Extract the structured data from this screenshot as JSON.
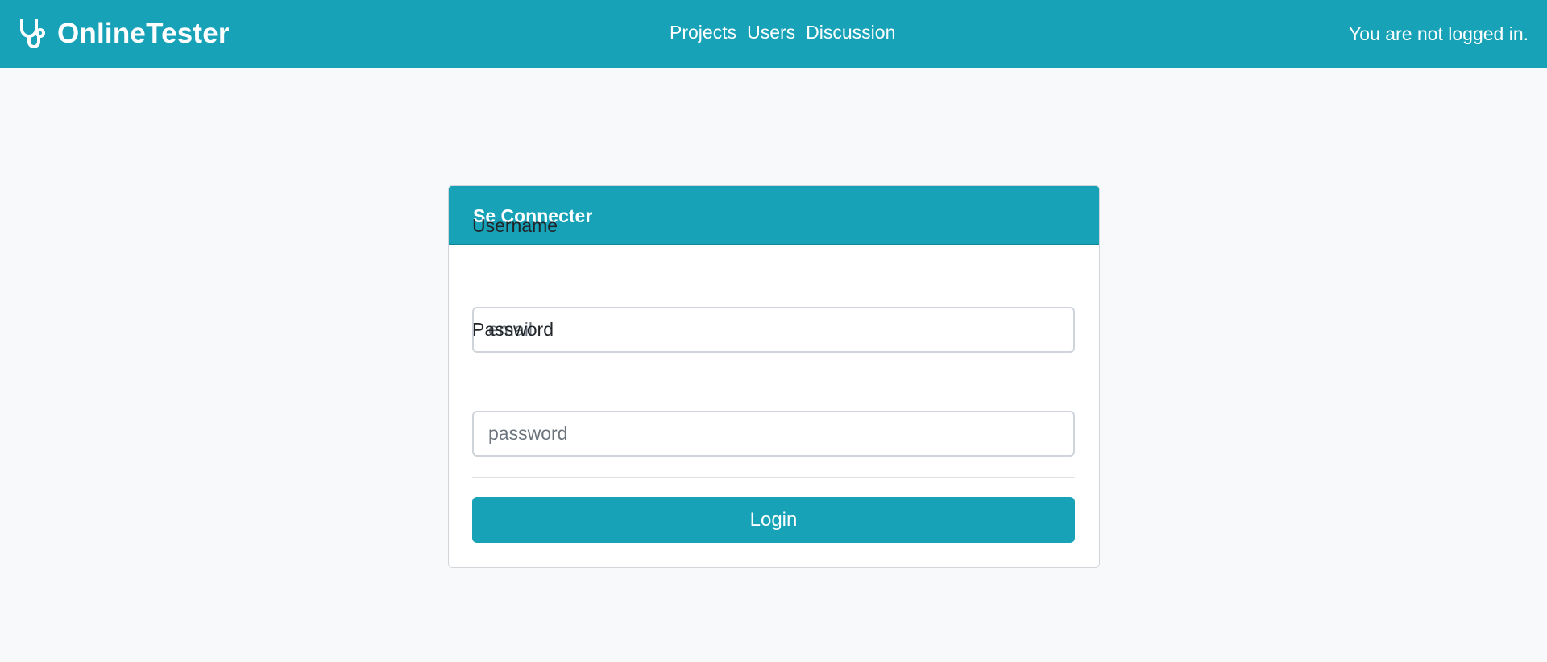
{
  "navbar": {
    "brand": "OnlineTester",
    "brand_icon": "stethoscope-icon",
    "links": [
      "Projects",
      "Users",
      "Discussion"
    ],
    "status": "You are not logged in.",
    "color": "#17a2b8"
  },
  "login_card": {
    "title": "Se Connecter",
    "username_label": "Username",
    "username_placeholder": "email",
    "password_label": "Password",
    "password_placeholder": "password",
    "submit_label": "Login"
  }
}
